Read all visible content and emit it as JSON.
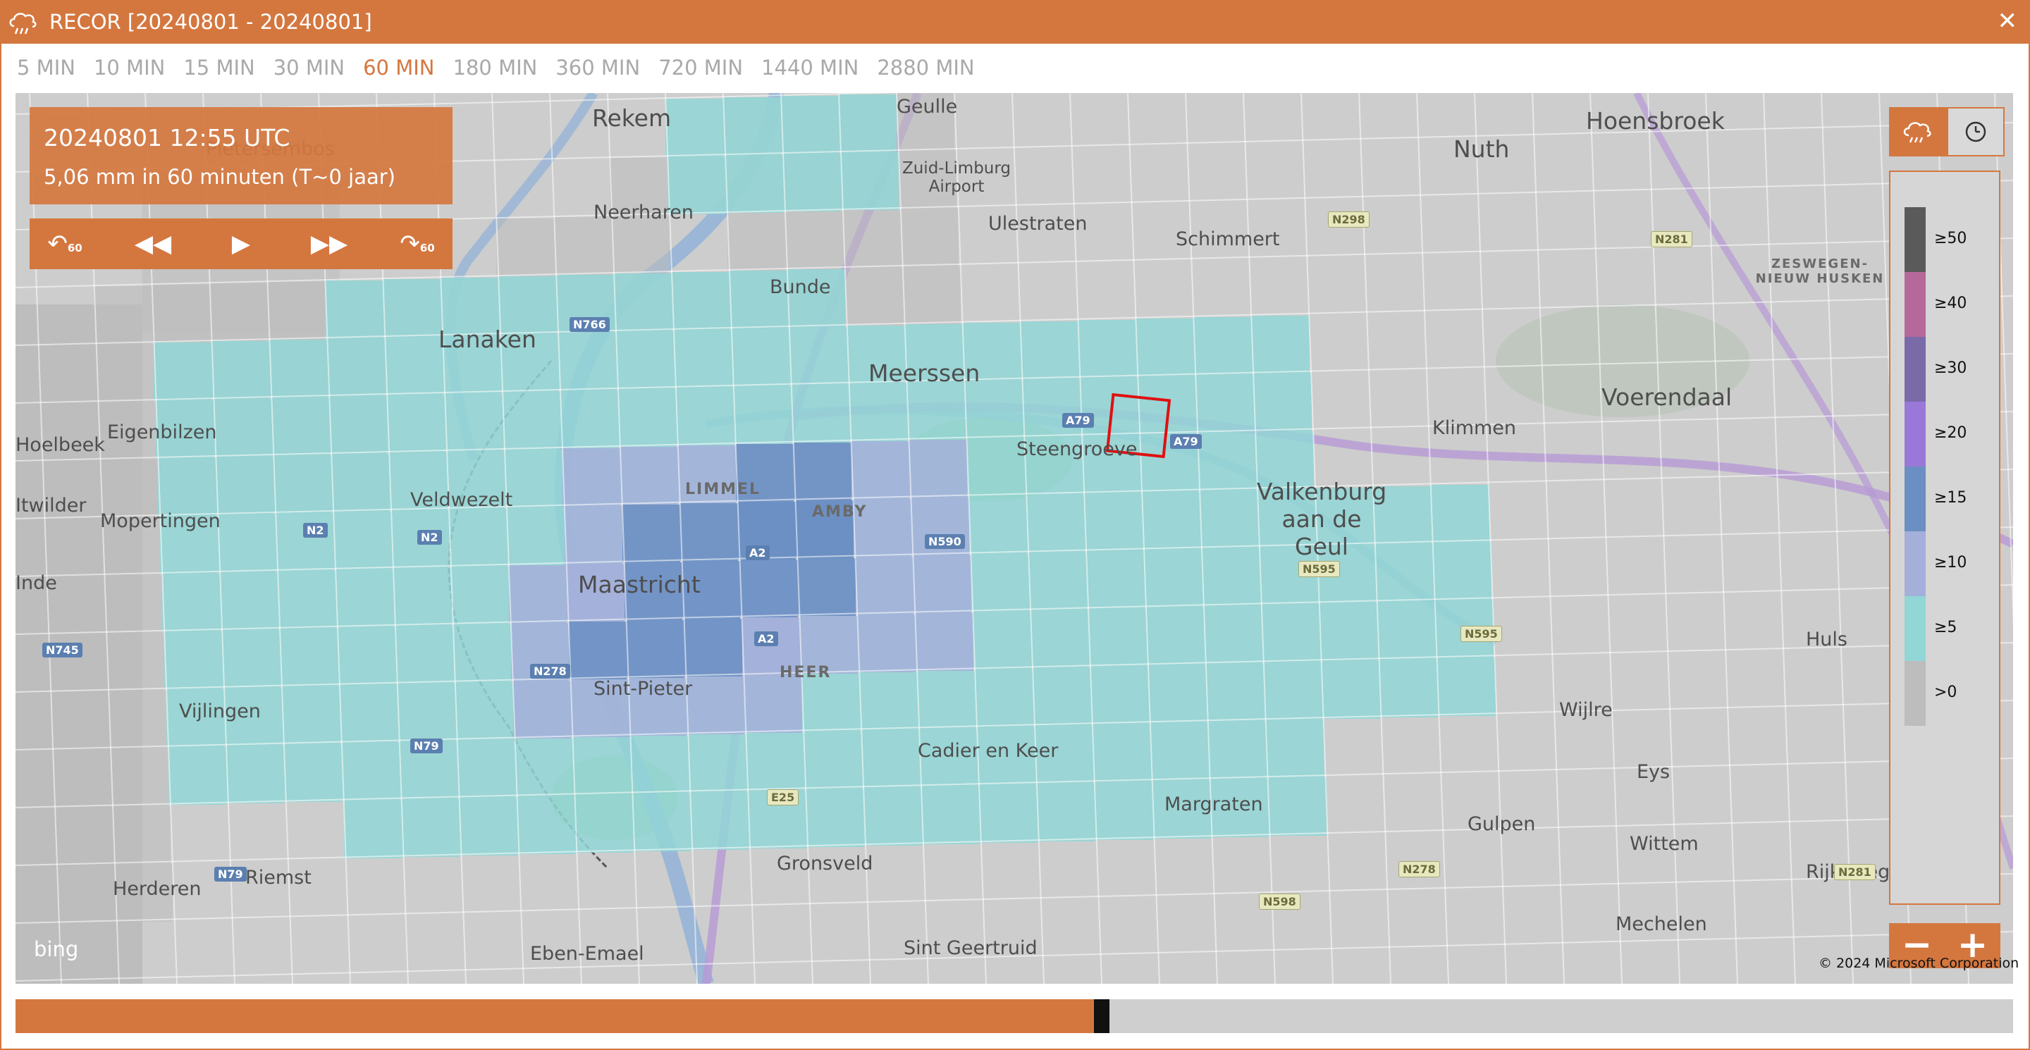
{
  "window": {
    "title": "RECOR [20240801 - 20240801]",
    "close_label": "✕",
    "accent_color": "#d4773f"
  },
  "tabs": [
    {
      "label": "5 MIN",
      "active": false
    },
    {
      "label": "10 MIN",
      "active": false
    },
    {
      "label": "15 MIN",
      "active": false
    },
    {
      "label": "30 MIN",
      "active": false
    },
    {
      "label": "60 MIN",
      "active": true
    },
    {
      "label": "180 MIN",
      "active": false
    },
    {
      "label": "360 MIN",
      "active": false
    },
    {
      "label": "720 MIN",
      "active": false
    },
    {
      "label": "1440 MIN",
      "active": false
    },
    {
      "label": "2880 MIN",
      "active": false
    }
  ],
  "info": {
    "datetime": "20240801 12:55 UTC",
    "amount": "5,06 mm in 60 minuten (T~0 jaar)"
  },
  "playback": {
    "back_step_label": "60",
    "rewind_icon": "rewind-icon",
    "play_icon": "play-icon",
    "forward_icon": "fast-forward-icon",
    "forward_step_label": "60"
  },
  "legend": {
    "items": [
      {
        "label": "≥50",
        "color": "#5a5a5a"
      },
      {
        "label": "≥40",
        "color": "#b5699a"
      },
      {
        "label": "≥30",
        "color": "#7b6aa8"
      },
      {
        "label": "≥20",
        "color": "#9a78d9"
      },
      {
        "label": "≥15",
        "color": "#6b8fc2"
      },
      {
        "label": "≥10",
        "color": "#a4b0d9"
      },
      {
        "label": "≥5",
        "color": "#92d6d6"
      },
      {
        "label": ">0",
        "color": "#bdbdbd"
      }
    ]
  },
  "map": {
    "places": [
      {
        "name": "Rekem",
        "cls": "big"
      },
      {
        "name": "Geulle",
        "cls": "mid"
      },
      {
        "name": "Hoensbroek",
        "cls": "big"
      },
      {
        "name": "Nuth",
        "cls": "big"
      },
      {
        "name": "Pietersembos",
        "cls": "mid"
      },
      {
        "name": "Zuid-Limburg Airport",
        "cls": "mid"
      },
      {
        "name": "Neerharen",
        "cls": "mid"
      },
      {
        "name": "Ulestraten",
        "cls": "mid"
      },
      {
        "name": "Schimmert",
        "cls": "mid"
      },
      {
        "name": "Bunde",
        "cls": "mid"
      },
      {
        "name": "ZESWEGEN-NIEUW HUSKEN",
        "cls": "small"
      },
      {
        "name": "Lanaken",
        "cls": "big"
      },
      {
        "name": "Meerssen",
        "cls": "big"
      },
      {
        "name": "Voerendaal",
        "cls": "big"
      },
      {
        "name": "Eigenbilzen",
        "cls": "mid"
      },
      {
        "name": "Klimmen",
        "cls": "mid"
      },
      {
        "name": "Hoelbeek",
        "cls": "mid"
      },
      {
        "name": "Steengroeve",
        "cls": "mid"
      },
      {
        "name": "Veldwezelt",
        "cls": "mid"
      },
      {
        "name": "LIMMEL",
        "cls": "small"
      },
      {
        "name": "Valkenburg aan de Geul",
        "cls": "big"
      },
      {
        "name": "Itwilder",
        "cls": "mid"
      },
      {
        "name": "Mopertingen",
        "cls": "mid"
      },
      {
        "name": "AMBY",
        "cls": "small"
      },
      {
        "name": "Maastricht",
        "cls": "big"
      },
      {
        "name": "Inde",
        "cls": "mid"
      },
      {
        "name": "Huls",
        "cls": "mid"
      },
      {
        "name": "HEER",
        "cls": "small"
      },
      {
        "name": "Sint-Pieter",
        "cls": "mid"
      },
      {
        "name": "Vijlingen",
        "cls": "mid"
      },
      {
        "name": "Wijlre",
        "cls": "mid"
      },
      {
        "name": "Cadier en Keer",
        "cls": "mid"
      },
      {
        "name": "Eys",
        "cls": "mid"
      },
      {
        "name": "Margraten",
        "cls": "mid"
      },
      {
        "name": "Gulpen",
        "cls": "mid"
      },
      {
        "name": "Wittem",
        "cls": "mid"
      },
      {
        "name": "Gronsveld",
        "cls": "mid"
      },
      {
        "name": "Herderen",
        "cls": "mid"
      },
      {
        "name": "Riemst",
        "cls": "mid"
      },
      {
        "name": "Eben-Emael",
        "cls": "mid"
      },
      {
        "name": "Sint Geertruid",
        "cls": "mid"
      },
      {
        "name": "Mechelen",
        "cls": "mid"
      },
      {
        "name": "Rijksweg",
        "cls": "mid"
      }
    ],
    "roads": [
      {
        "label": "N766",
        "cls": ""
      },
      {
        "label": "N298",
        "cls": "green"
      },
      {
        "label": "N281",
        "cls": "green"
      },
      {
        "label": "A79",
        "cls": ""
      },
      {
        "label": "A79",
        "cls": ""
      },
      {
        "label": "N2",
        "cls": ""
      },
      {
        "label": "N2",
        "cls": ""
      },
      {
        "label": "A2",
        "cls": ""
      },
      {
        "label": "N590",
        "cls": ""
      },
      {
        "label": "N595",
        "cls": "green"
      },
      {
        "label": "N595",
        "cls": "green"
      },
      {
        "label": "A2",
        "cls": ""
      },
      {
        "label": "N745",
        "cls": ""
      },
      {
        "label": "N278",
        "cls": ""
      },
      {
        "label": "N79",
        "cls": ""
      },
      {
        "label": "E25",
        "cls": "green"
      },
      {
        "label": "N278",
        "cls": "green"
      },
      {
        "label": "N281",
        "cls": "green"
      },
      {
        "label": "N79",
        "cls": ""
      },
      {
        "label": "N598",
        "cls": "green"
      }
    ],
    "attribution": "bing",
    "copyright": "© 2024 Microsoft Corporation"
  },
  "timeline": {
    "progress": 0.54
  }
}
